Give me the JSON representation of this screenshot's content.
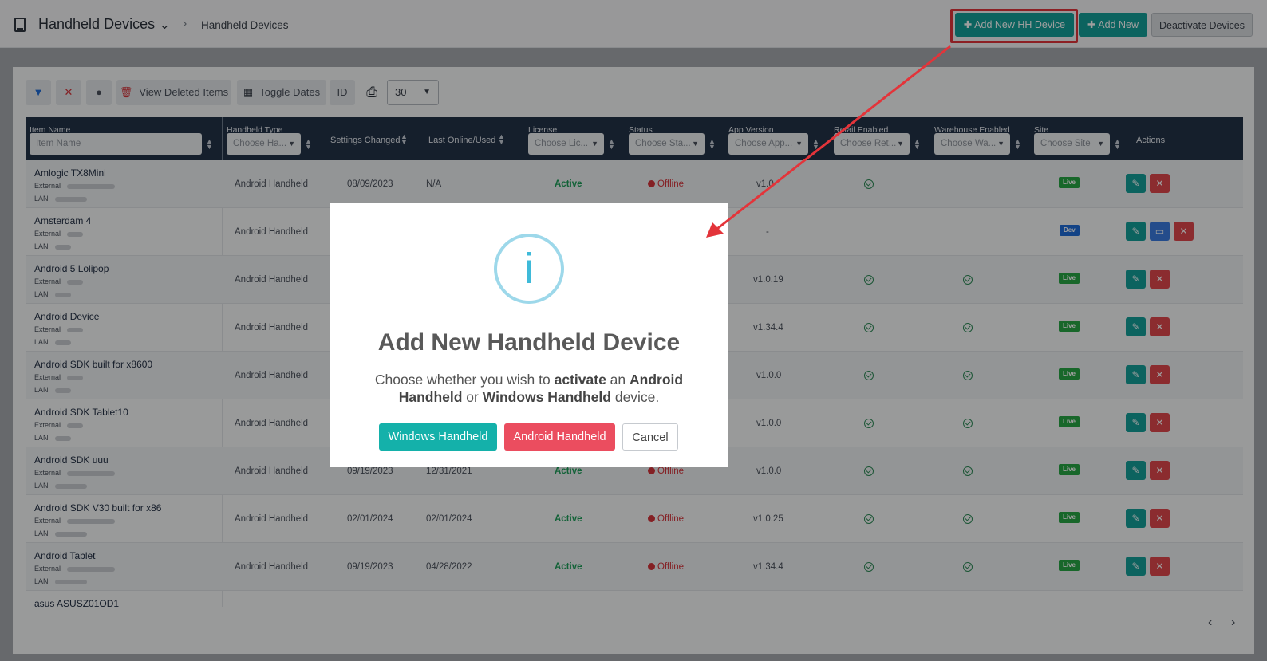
{
  "header": {
    "title": "Handheld Devices",
    "breadcrumb": "Handheld Devices",
    "buttons": {
      "add_hh": "Add New HH Device",
      "add_new": "Add New",
      "deactivate": "Deactivate Devices"
    }
  },
  "toolbar": {
    "view_deleted": "View Deleted Items",
    "toggle_dates": "Toggle Dates",
    "id": "ID",
    "page_size": "30"
  },
  "table": {
    "headers": {
      "item_name": "Item Name",
      "handheld_type": "Handheld Type",
      "settings_changed": "Settings Changed",
      "last_online": "Last Online/Used",
      "license": "License",
      "status": "Status",
      "app_version": "App Version",
      "retail_enabled": "Retail Enabled",
      "warehouse_enabled": "Warehouse Enabled",
      "site": "Site",
      "actions": "Actions"
    },
    "filters": {
      "item_name": "Item Name",
      "handheld_type": "Choose Ha...",
      "license": "Choose Lic...",
      "status": "Choose Sta...",
      "app_version": "Choose App...",
      "retail": "Choose Ret...",
      "warehouse": "Choose Wa...",
      "site": "Choose Site"
    },
    "ext_label": "External",
    "lan_label": "LAN",
    "rows": [
      {
        "name": "Amlogic TX8Mini",
        "type": "Android Handheld",
        "settings": "08/09/2023",
        "last": "N/A",
        "license": "Active",
        "status": "Offline",
        "version": "v1.0",
        "retail": true,
        "warehouse": false,
        "site": "Live",
        "card": false
      },
      {
        "name": "Amsterdam 4",
        "type": "Android Handheld",
        "settings": "",
        "last": "",
        "license": "",
        "status": "",
        "version": "-",
        "retail": false,
        "warehouse": false,
        "site": "Dev",
        "card": true
      },
      {
        "name": "Android 5 Lolipop",
        "type": "Android Handheld",
        "settings": "",
        "last": "",
        "license": "",
        "status": "",
        "version": "v1.0.19",
        "retail": true,
        "warehouse": true,
        "site": "Live",
        "card": false
      },
      {
        "name": "Android Device",
        "type": "Android Handheld",
        "settings": "",
        "last": "",
        "license": "",
        "status": "",
        "version": "v1.34.4",
        "retail": true,
        "warehouse": true,
        "site": "Live",
        "card": false
      },
      {
        "name": "Android SDK built for x8600",
        "type": "Android Handheld",
        "settings": "",
        "last": "",
        "license": "",
        "status": "",
        "version": "v1.0.0",
        "retail": true,
        "warehouse": true,
        "site": "Live",
        "card": false
      },
      {
        "name": "Android SDK Tablet10",
        "type": "Android Handheld",
        "settings": "",
        "last": "",
        "license": "",
        "status": "",
        "version": "v1.0.0",
        "retail": true,
        "warehouse": true,
        "site": "Live",
        "card": false
      },
      {
        "name": "Android SDK uuu",
        "type": "Android Handheld",
        "settings": "09/19/2023",
        "last": "12/31/2021",
        "license": "Active",
        "status": "Offline",
        "version": "v1.0.0",
        "retail": true,
        "warehouse": true,
        "site": "Live",
        "card": false
      },
      {
        "name": "Android SDK V30 built for x86",
        "type": "Android Handheld",
        "settings": "02/01/2024",
        "last": "02/01/2024",
        "license": "Active",
        "status": "Offline",
        "version": "v1.0.25",
        "retail": true,
        "warehouse": true,
        "site": "Live",
        "card": false
      },
      {
        "name": "Android Tablet",
        "type": "Android Handheld",
        "settings": "09/19/2023",
        "last": "04/28/2022",
        "license": "Active",
        "status": "Offline",
        "version": "v1.34.4",
        "retail": true,
        "warehouse": true,
        "site": "Live",
        "card": false
      },
      {
        "name": "asus ASUSZ01QD1",
        "type": "",
        "settings": "",
        "last": "",
        "license": "",
        "status": "",
        "version": "",
        "retail": false,
        "warehouse": false,
        "site": "",
        "card": false
      }
    ]
  },
  "pagination": {
    "prev": "‹",
    "next": "›"
  },
  "modal": {
    "icon": "i",
    "title": "Add New Handheld Device",
    "text_1": "Choose whether you wish to ",
    "text_bold_1": "activate",
    "text_2": " an ",
    "text_bold_2": "Android Handheld",
    "text_3": " or ",
    "text_bold_3": "Windows Handheld",
    "text_4": " device.",
    "btn_windows": "Windows Handheld",
    "btn_android": "Android Handheld",
    "btn_cancel": "Cancel"
  },
  "colors": {
    "accent": "#14a09a",
    "danger": "#e0474c",
    "header": "#223248",
    "annotation": "#e3343a"
  }
}
